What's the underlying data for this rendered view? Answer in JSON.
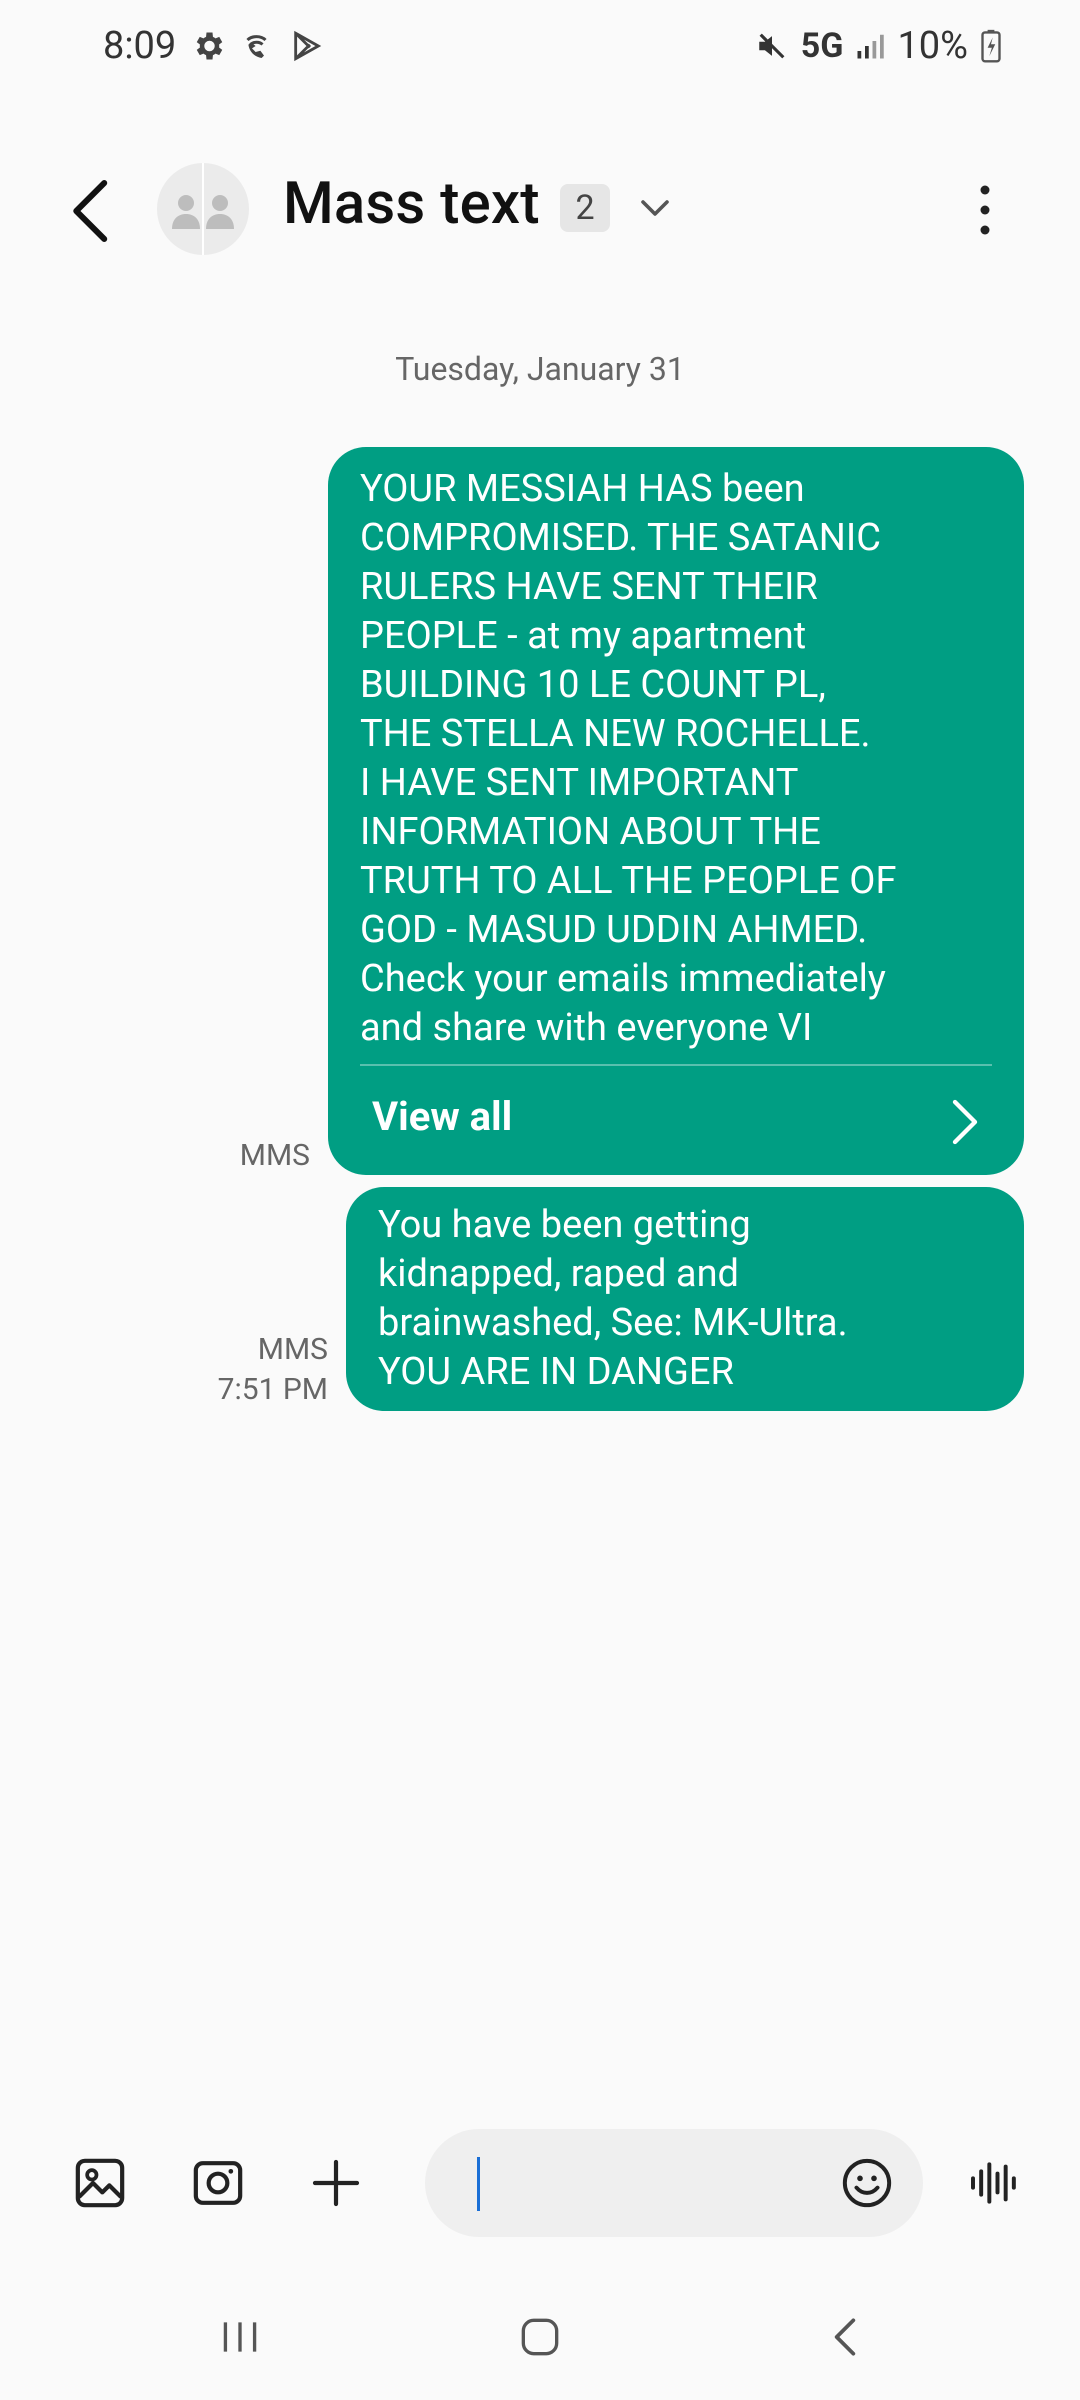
{
  "status_bar": {
    "time": "8:09",
    "network": "5G",
    "battery": "10%"
  },
  "header": {
    "title": "Mass text",
    "participant_count": "2"
  },
  "conversation": {
    "date_divider": "Tuesday, January 31",
    "messages": [
      {
        "text": "YOUR MESSIAH HAS been\nCOMPROMISED.  THE SATANIC\nRULERS HAVE SENT THEIR\nPEOPLE - at my apartment\nBUILDING 10 LE COUNT PL,\nTHE STELLA NEW ROCHELLE.\nI HAVE SENT IMPORTANT\nINFORMATION ABOUT THE\nTRUTH TO ALL THE PEOPLE OF\nGOD - MASUD UDDIN AHMED.\nCheck your emails immediately\nand share with everyone VI",
        "action_label": "View all",
        "type_label": "MMS"
      },
      {
        "text": "You have been getting\nkidnapped, raped and\nbrainwashed, See: MK-Ultra.\nYOU ARE IN DANGER",
        "type_label": "MMS",
        "time": "7:51 PM"
      }
    ]
  },
  "colors": {
    "bubble": "#009e83",
    "background": "#fafafa",
    "caret": "#1a6fd6"
  }
}
